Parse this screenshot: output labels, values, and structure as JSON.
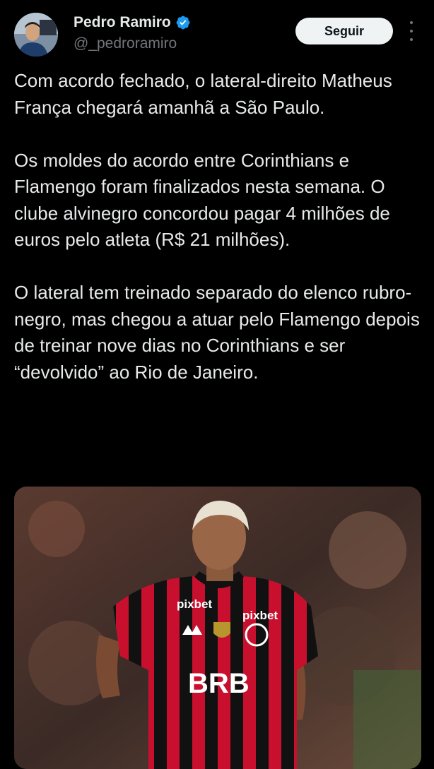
{
  "author": {
    "name": "Pedro Ramiro",
    "handle": "@_pedroramiro",
    "verified": true
  },
  "actions": {
    "follow_label": "Seguir"
  },
  "tweet": {
    "paragraphs": [
      "Com acordo fechado, o lateral-direito Matheus França chegará amanhã a São Paulo.",
      "Os moldes do acordo entre Corinthians e Flamengo foram finalizados nesta semana. O clube alvinegro concordou pagar 4 milhões de euros pelo atleta (R$ 21 milhões).",
      "O lateral tem treinado separado do elenco rubro-negro, mas chegou a atuar pelo Flamengo depois de treinar nove dias no Corinthians e ser “devolvido” ao Rio de Janeiro."
    ]
  },
  "media": {
    "jersey_sponsor": "BRB",
    "jersey_shoulder_text": "pixbet",
    "jersey_chest_text": "pixbet"
  },
  "colors": {
    "accent_verified": "#1d9bf0",
    "background": "#000000",
    "text_primary": "#e7e9ea",
    "text_secondary": "#71767b",
    "jersey_red": "#c8102e"
  },
  "icons": {
    "verified": "verified-badge-icon",
    "more": "more-options-icon"
  }
}
